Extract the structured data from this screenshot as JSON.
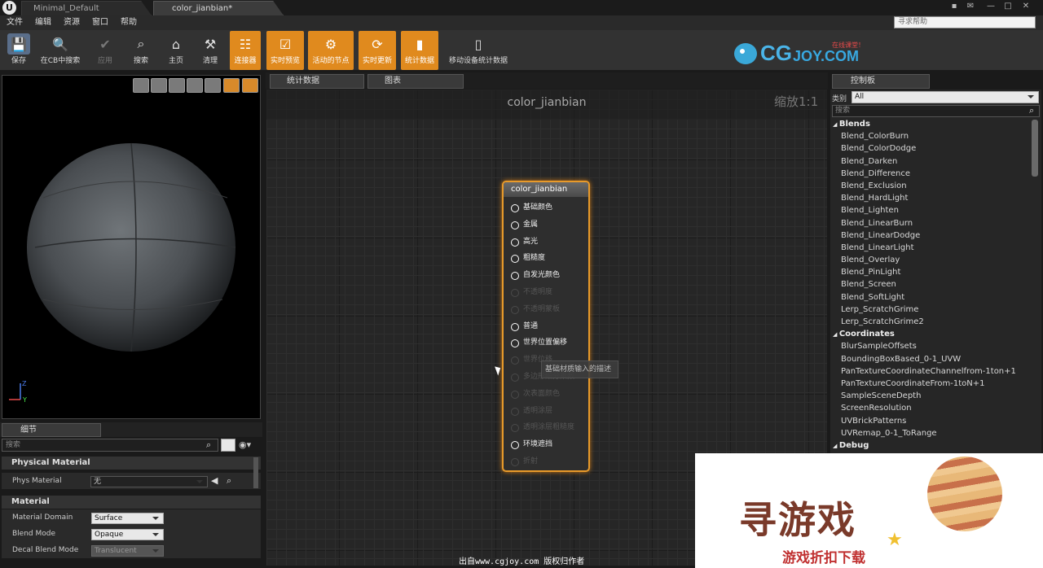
{
  "titlebar": {
    "tab1": "Minimal_Default",
    "tab2": "color_jianbian*"
  },
  "menu": {
    "items": [
      "文件",
      "编辑",
      "资源",
      "窗口",
      "帮助"
    ],
    "search_placeholder": "寻求帮助"
  },
  "toolbar": {
    "buttons": [
      "保存",
      "在CB中搜索",
      "应用",
      "搜索",
      "主页",
      "清理",
      "连接器",
      "实时预览",
      "活动的节点",
      "实时更新",
      "统计数据",
      "移动设备统计数据"
    ]
  },
  "logo": {
    "text": "CGJOY.COM",
    "tagline": "在线课堂！"
  },
  "details": {
    "tab": "细节",
    "search_placeholder": "搜索",
    "sections": {
      "physical": "Physical Material",
      "material": "Material"
    },
    "props": {
      "phys_material": {
        "label": "Phys Material",
        "value": "无"
      },
      "material_domain": {
        "label": "Material Domain",
        "value": "Surface"
      },
      "blend_mode": {
        "label": "Blend Mode",
        "value": "Opaque"
      },
      "decal_blend_mode": {
        "label": "Decal Blend Mode",
        "value": "Translucent"
      }
    }
  },
  "graph": {
    "tabs": [
      "统计数据",
      "图表"
    ],
    "title": "color_jianbian",
    "zoom": "缩放1:1",
    "node_title": "color_jianbian",
    "pins": [
      {
        "label": "基础颜色",
        "enabled": true
      },
      {
        "label": "金属",
        "enabled": true
      },
      {
        "label": "高光",
        "enabled": true
      },
      {
        "label": "粗糙度",
        "enabled": true
      },
      {
        "label": "自发光颜色",
        "enabled": true
      },
      {
        "label": "不透明度",
        "enabled": false
      },
      {
        "label": "不透明蒙板",
        "enabled": false
      },
      {
        "label": "普通",
        "enabled": true
      },
      {
        "label": "世界位置偏移",
        "enabled": true
      },
      {
        "label": "世界位移",
        "enabled": false
      },
      {
        "label": "多边形细分乘数",
        "enabled": false
      },
      {
        "label": "次表面颜色",
        "enabled": false
      },
      {
        "label": "透明涂层",
        "enabled": false
      },
      {
        "label": "透明涂层粗糙度",
        "enabled": false
      },
      {
        "label": "环境遮挡",
        "enabled": true
      },
      {
        "label": "折射",
        "enabled": false
      }
    ],
    "tooltip": "基础材质输入的描述",
    "credit": "出自www.cgjoy.com 版权归作者"
  },
  "palette": {
    "tab": "控制板",
    "category_label": "类别",
    "category_value": "All",
    "search_placeholder": "搜索",
    "items": [
      {
        "text": "Blends",
        "cat": true
      },
      {
        "text": "Blend_ColorBurn"
      },
      {
        "text": "Blend_ColorDodge"
      },
      {
        "text": "Blend_Darken"
      },
      {
        "text": "Blend_Difference"
      },
      {
        "text": "Blend_Exclusion"
      },
      {
        "text": "Blend_HardLight"
      },
      {
        "text": "Blend_Lighten"
      },
      {
        "text": "Blend_LinearBurn"
      },
      {
        "text": "Blend_LinearDodge"
      },
      {
        "text": "Blend_LinearLight"
      },
      {
        "text": "Blend_Overlay"
      },
      {
        "text": "Blend_PinLight"
      },
      {
        "text": "Blend_Screen"
      },
      {
        "text": "Blend_SoftLight"
      },
      {
        "text": "Lerp_ScratchGrime"
      },
      {
        "text": "Lerp_ScratchGrime2"
      },
      {
        "text": "Coordinates",
        "cat": true
      },
      {
        "text": "BlurSampleOffsets"
      },
      {
        "text": "BoundingBoxBased_0-1_UVW"
      },
      {
        "text": "PanTextureCoordinateChannelfrom-1ton+1"
      },
      {
        "text": "PanTextureCoordinateFrom-1toN+1"
      },
      {
        "text": "SampleSceneDepth"
      },
      {
        "text": "ScreenResolution"
      },
      {
        "text": "UVBrickPatterns"
      },
      {
        "text": "UVRemap_0-1_ToRange"
      },
      {
        "text": "Debug",
        "cat": true
      }
    ]
  },
  "ad": {
    "main": "寻游戏",
    "sub": "游戏折扣下载"
  },
  "colors": {
    "accent": "#e08a1e",
    "node_border": "#e89a2a"
  }
}
